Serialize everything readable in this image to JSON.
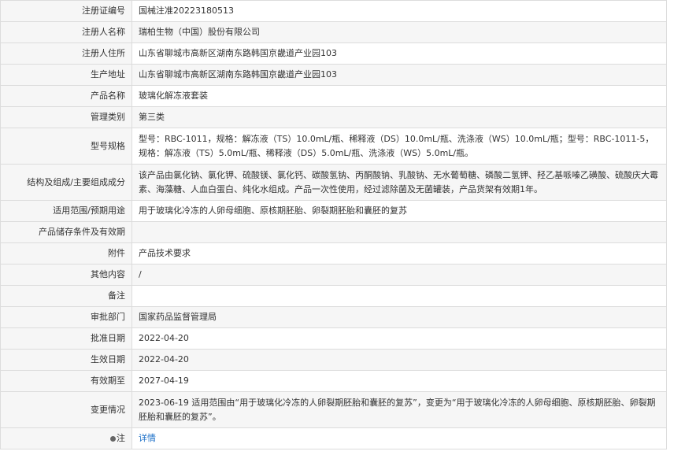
{
  "rows": [
    {
      "label": "注册证编号",
      "value": "国械注准20223180513"
    },
    {
      "label": "注册人名称",
      "value": "瑞柏生物（中国）股份有限公司"
    },
    {
      "label": "注册人住所",
      "value": "山东省聊城市高新区湖南东路韩国京畿道产业园103"
    },
    {
      "label": "生产地址",
      "value": "山东省聊城市高新区湖南东路韩国京畿道产业园103"
    },
    {
      "label": "产品名称",
      "value": "玻璃化解冻液套装"
    },
    {
      "label": "管理类别",
      "value": "第三类"
    },
    {
      "label": "型号规格",
      "value": "型号：RBC-1011，规格：解冻液（TS）10.0mL/瓶、稀释液（DS）10.0mL/瓶、洗涤液（WS）10.0mL/瓶；型号：RBC-1011-5，规格：解冻液（TS）5.0mL/瓶、稀释液（DS）5.0mL/瓶、洗涤液（WS）5.0mL/瓶。"
    },
    {
      "label": "结构及组成/主要组成成分",
      "value": "该产品由氯化钠、氯化钾、硫酸镁、氯化钙、碳酸氢钠、丙酮酸钠、乳酸钠、无水葡萄糖、磷酸二氢钾、羟乙基哌嗪乙磺酸、硫酸庆大霉素、海藻糖、人血白蛋白、纯化水组成。产品一次性使用，经过滤除菌及无菌罐装，产品货架有效期1年。"
    },
    {
      "label": "适用范围/预期用途",
      "value": "用于玻璃化冷冻的人卵母细胞、原核期胚胎、卵裂期胚胎和囊胚的复苏"
    },
    {
      "label": "产品储存条件及有效期",
      "value": ""
    },
    {
      "label": "附件",
      "value": "产品技术要求"
    },
    {
      "label": "其他内容",
      "value": "/"
    },
    {
      "label": "备注",
      "value": ""
    },
    {
      "label": "审批部门",
      "value": "国家药品监督管理局"
    },
    {
      "label": "批准日期",
      "value": "2022-04-20"
    },
    {
      "label": "生效日期",
      "value": "2022-04-20"
    },
    {
      "label": "有效期至",
      "value": "2027-04-19"
    },
    {
      "label": "变更情况",
      "value": "2023-06-19 适用范围由“用于玻璃化冷冻的人卵裂期胚胎和囊胚的复苏”，变更为“用于玻璃化冷冻的人卵母细胞、原核期胚胎、卵裂期胚胎和囊胚的复苏”。"
    }
  ],
  "note_row": {
    "label": "注",
    "link": "详情"
  }
}
